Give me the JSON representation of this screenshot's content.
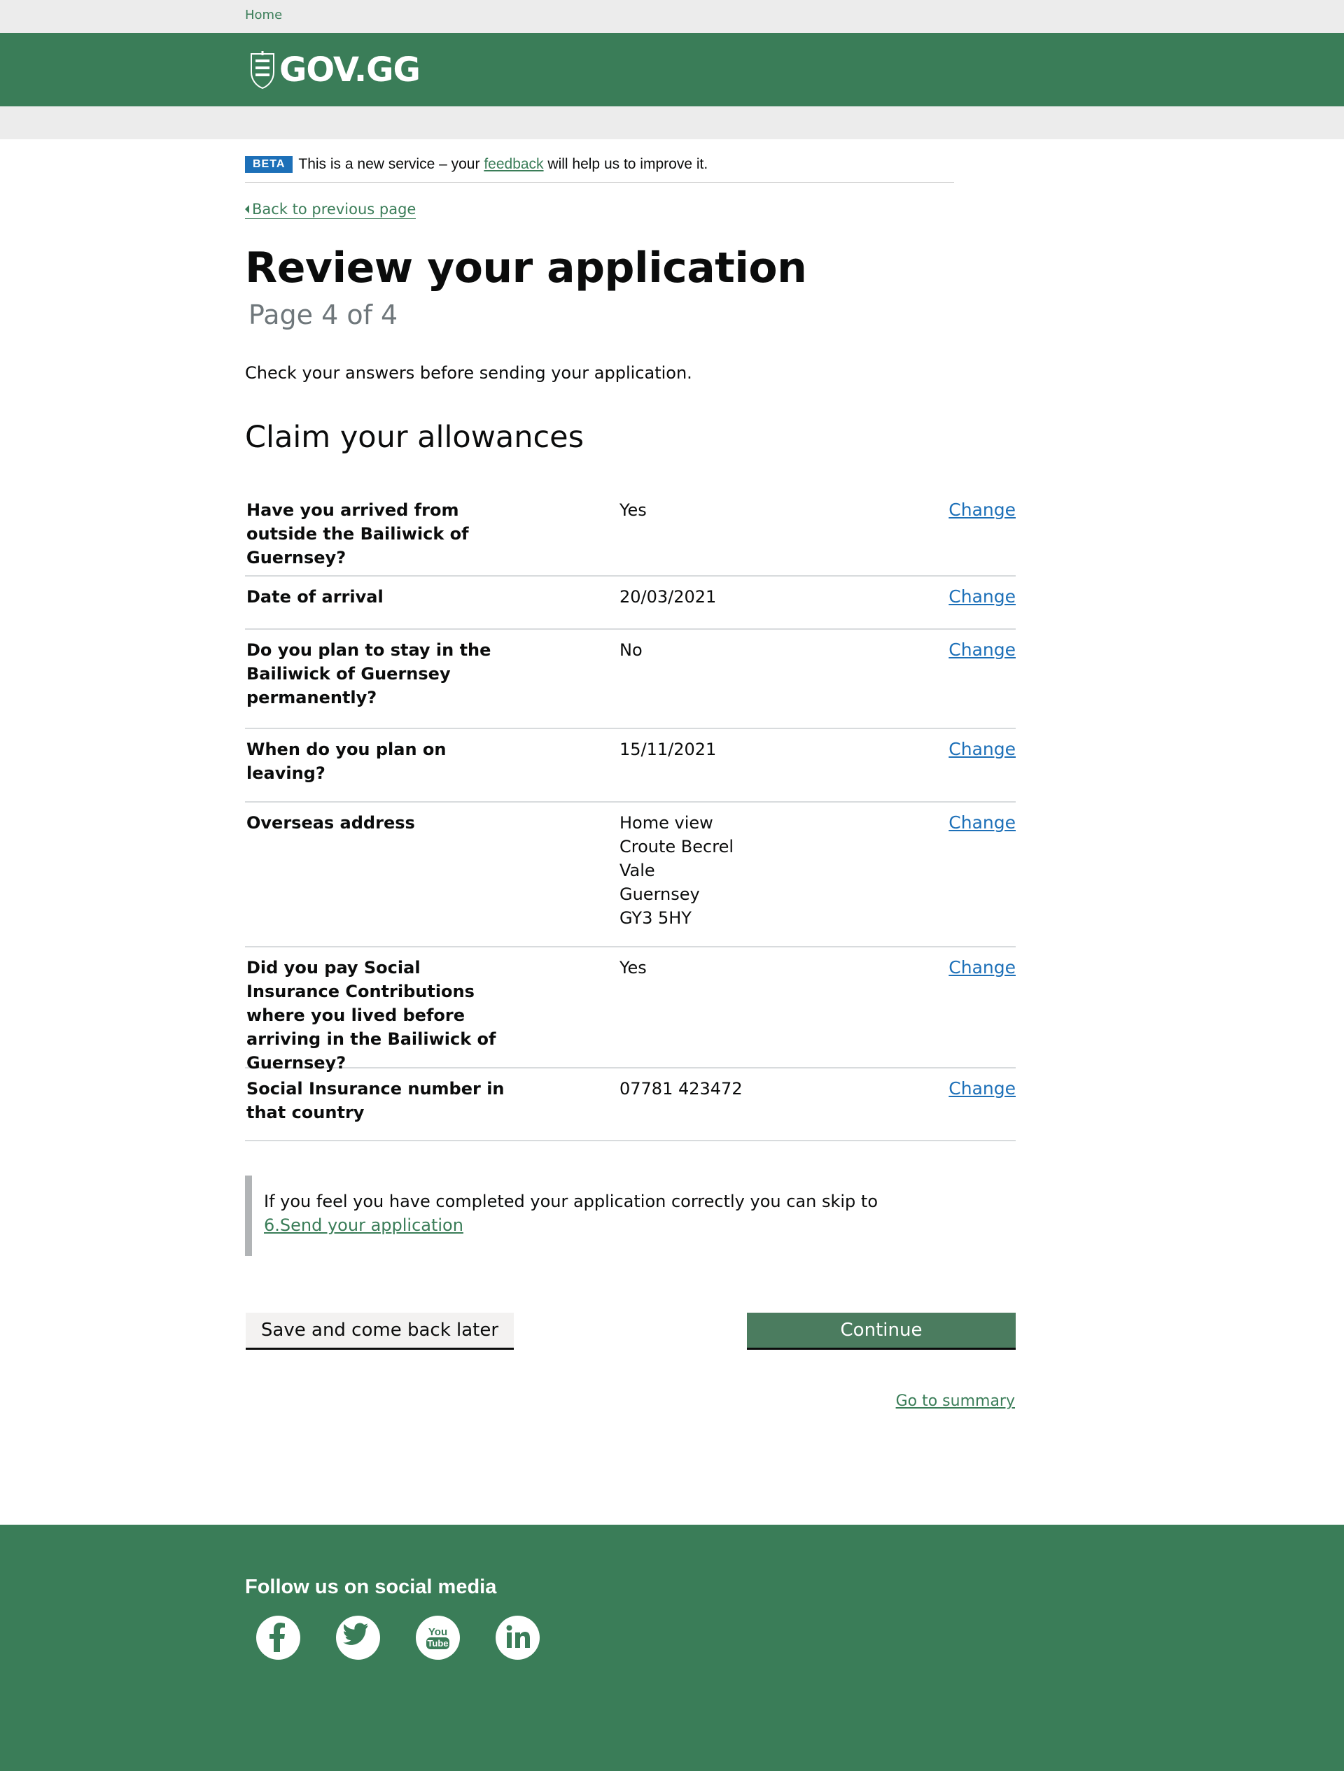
{
  "topbar": {
    "home_label": "Home"
  },
  "header": {
    "logo_text": "GOV.GG"
  },
  "beta_banner": {
    "tag": "BETA",
    "text_before": "This is a new service – your",
    "link": "feedback",
    "text_after": "will help us to improve it."
  },
  "nav": {
    "back_label": "Back to previous page"
  },
  "page": {
    "title": "Review your application",
    "page_indicator": "Page 4 of 4",
    "intro": "Check your answers before sending your application.",
    "section_title": "Claim your allowances"
  },
  "summary": {
    "change_label": "Change",
    "rows": [
      {
        "key": "Have you arrived from outside the Bailiwick of Guernsey?",
        "value": "Yes"
      },
      {
        "key": "Date of arrival",
        "value": "20/03/2021"
      },
      {
        "key": "Do you plan to stay in the Bailiwick of Guernsey permanently?",
        "value": "No"
      },
      {
        "key": "When do you plan on leaving?",
        "value": "15/11/2021"
      },
      {
        "key": "Overseas address",
        "value_lines": [
          "Home view",
          "Croute Becrel",
          "Vale",
          "Guernsey",
          "GY3 5HY"
        ]
      },
      {
        "key": "Did you pay Social Insurance Contributions where you lived before arriving in the Bailiwick of Guernsey?",
        "value": "Yes"
      },
      {
        "key": "Social Insurance number in that country",
        "value": "07781 423472"
      }
    ]
  },
  "inset": {
    "text": "If you feel you have completed your application correctly you can skip to",
    "link": "6.Send your application"
  },
  "actions": {
    "save_label": "Save and come back later",
    "continue_label": "Continue",
    "summary_link": "Go to summary"
  },
  "footer": {
    "follow_heading": "Follow us on social media",
    "socials": [
      "facebook-icon",
      "twitter-icon",
      "youtube-icon",
      "linkedin-icon"
    ]
  },
  "colors": {
    "brand_green": "#3a7d58",
    "button_green": "#4b7c5f",
    "link_blue": "#1d70b8",
    "beta_blue": "#1d70b8"
  }
}
